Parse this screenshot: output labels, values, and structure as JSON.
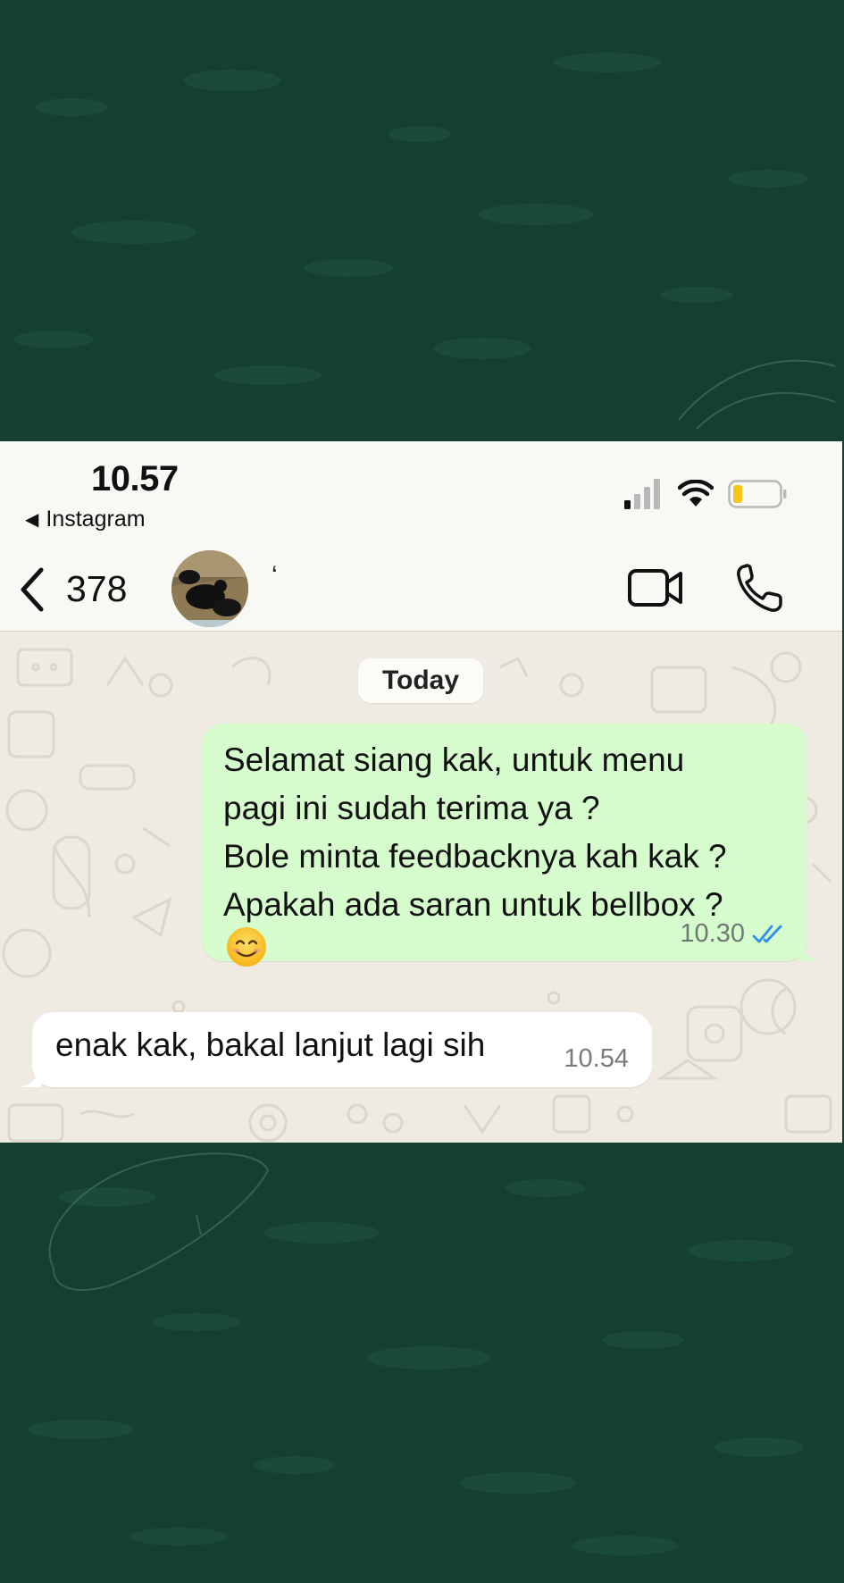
{
  "status_bar": {
    "time": "10.57",
    "back_app": "Instagram"
  },
  "header": {
    "back_count": "378",
    "contact_name": "‘"
  },
  "chat": {
    "date_label": "Today",
    "messages": [
      {
        "direction": "outgoing",
        "text": "Selamat siang kak, untuk menu\npagi ini sudah terima ya ?\nBole minta feedbacknya kah kak ?\nApakah ada saran untuk bellbox ?",
        "emoji": "smiling-face-emoji",
        "time": "10.30",
        "status": "read"
      },
      {
        "direction": "incoming",
        "text": "enak kak, bakal lanjut lagi sih",
        "time": "10.54"
      }
    ]
  },
  "colors": {
    "outer_background": "#153f30",
    "outgoing_bubble": "#d6fbcc",
    "incoming_bubble": "#ffffff",
    "chat_wallpaper": "#efeae2",
    "read_ticks": "#2f8ef0",
    "battery_fill": "#f5c518"
  }
}
